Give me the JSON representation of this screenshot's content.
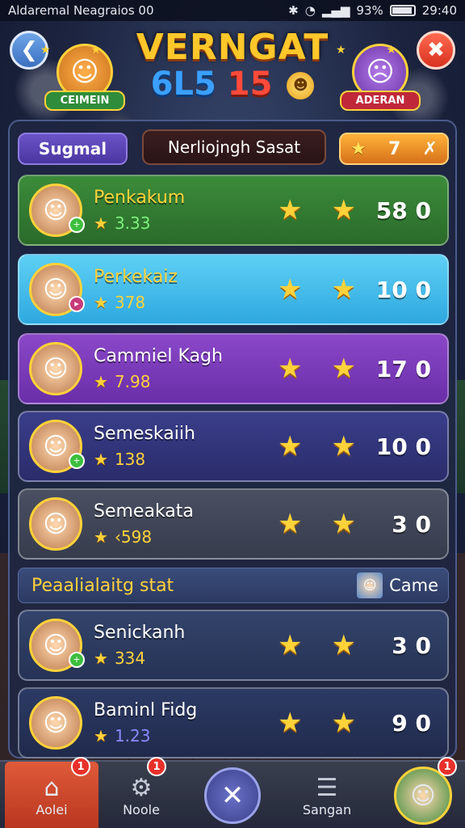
{
  "status_bar": {
    "carrier": "Aldaremal Neagraios  00",
    "battery": "93%",
    "time": "29:40"
  },
  "header": {
    "title": "VERNGAT",
    "score_left": "6L5",
    "score_right": "15",
    "team_left": {
      "label": "CEIMEIN",
      "icon": "player-face-icon"
    },
    "team_right": {
      "label": "ADERAN",
      "icon": "rival-face-icon"
    }
  },
  "tabs": {
    "left": "Sugmal",
    "middle": "Nerliojngh Sasat",
    "right_count": "7"
  },
  "players": [
    {
      "name": "Penkakum",
      "score": "3.33",
      "points": "58 0"
    },
    {
      "name": "Perkekaiz",
      "score": "378",
      "points": "10 0"
    },
    {
      "name": "Cammiel Kagh",
      "score": "7.98",
      "points": "17 0"
    },
    {
      "name": "Semeskaiih",
      "score": "138",
      "points": "10 0"
    },
    {
      "name": "Semeakata",
      "score": "‹598",
      "points": "3 0"
    }
  ],
  "section": {
    "label": "Peaalialaitg stat",
    "game_label": "Came"
  },
  "players_lower": [
    {
      "name": "Senickanh",
      "score": "334",
      "points": "3 0"
    },
    {
      "name": "Baminl Fidg",
      "score": "1.23",
      "points": "9 0"
    }
  ],
  "bottom_nav": {
    "home": "Aolei",
    "noole": "Noole",
    "sangan": "Sangan",
    "badge": "1"
  },
  "colors": {
    "accent_gold": "#ffd23a",
    "row_green": "#3c8c3a",
    "row_cyan": "#2ea8e0",
    "row_purple": "#8a48c8",
    "nav_active": "#e05a3a"
  }
}
